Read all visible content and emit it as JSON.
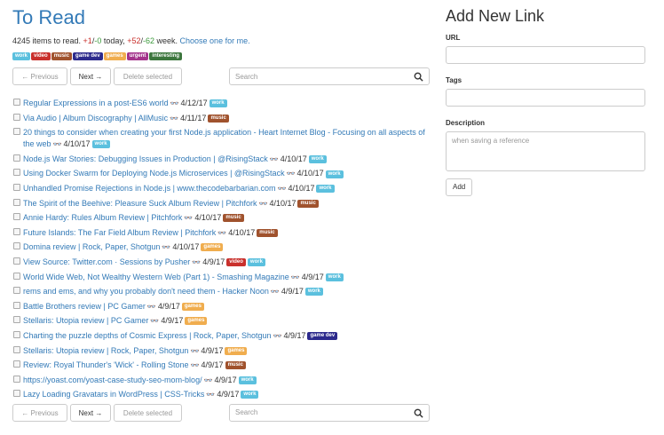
{
  "left": {
    "title": "To Read",
    "summary": {
      "items_text": "4245 items to read. ",
      "today_plus": "+1",
      "today_sep": "/",
      "today_minus": "-0",
      "today_text": " today, ",
      "week_plus": "+52",
      "week_sep": "/",
      "week_minus": "-62",
      "week_text": " week. ",
      "choose_link": "Choose one for me."
    },
    "tag_filters": [
      {
        "label": "work",
        "color": "#5bc0de"
      },
      {
        "label": "video",
        "color": "#c9302c"
      },
      {
        "label": "music",
        "color": "#a0522d"
      },
      {
        "label": "game dev",
        "color": "#2c2a8c"
      },
      {
        "label": "games",
        "color": "#f0ad4e"
      },
      {
        "label": "urgent",
        "color": "#a4348c"
      },
      {
        "label": "interesting",
        "color": "#3c763d"
      }
    ],
    "controls": {
      "previous": "← Previous",
      "next": "Next →",
      "delete": "Delete selected",
      "search_placeholder": "Search"
    },
    "links": [
      {
        "title": "Regular Expressions in a post-ES6 world",
        "date": "4/12/17",
        "tags": [
          {
            "label": "work",
            "color": "#5bc0de"
          }
        ]
      },
      {
        "title": "Via Audio | Album Discography | AllMusic",
        "date": "4/11/17",
        "tags": [
          {
            "label": "music",
            "color": "#a0522d"
          }
        ]
      },
      {
        "title": "20 things to consider when creating your first Node.js application - Heart Internet Blog - Focusing on all aspects of the web",
        "date": "4/10/17",
        "tags": [
          {
            "label": "work",
            "color": "#5bc0de"
          }
        ]
      },
      {
        "title": "Node.js War Stories: Debugging Issues in Production | @RisingStack",
        "date": "4/10/17",
        "tags": [
          {
            "label": "work",
            "color": "#5bc0de"
          }
        ]
      },
      {
        "title": "Using Docker Swarm for Deploying Node.js Microservices | @RisingStack",
        "date": "4/10/17",
        "tags": [
          {
            "label": "work",
            "color": "#5bc0de"
          }
        ]
      },
      {
        "title": "Unhandled Promise Rejections in Node.js | www.thecodebarbarian.com",
        "date": "4/10/17",
        "tags": [
          {
            "label": "work",
            "color": "#5bc0de"
          }
        ]
      },
      {
        "title": "The Spirit of the Beehive: Pleasure Suck Album Review | Pitchfork",
        "date": "4/10/17",
        "tags": [
          {
            "label": "music",
            "color": "#a0522d"
          }
        ]
      },
      {
        "title": "Annie Hardy: Rules Album Review | Pitchfork",
        "date": "4/10/17",
        "tags": [
          {
            "label": "music",
            "color": "#a0522d"
          }
        ]
      },
      {
        "title": "Future Islands: The Far Field Album Review | Pitchfork",
        "date": "4/10/17",
        "tags": [
          {
            "label": "music",
            "color": "#a0522d"
          }
        ]
      },
      {
        "title": "Domina review | Rock, Paper, Shotgun",
        "date": "4/10/17",
        "tags": [
          {
            "label": "games",
            "color": "#f0ad4e"
          }
        ]
      },
      {
        "title": "View Source: Twitter.com · Sessions by Pusher",
        "date": "4/9/17",
        "tags": [
          {
            "label": "video",
            "color": "#c9302c"
          },
          {
            "label": "work",
            "color": "#5bc0de"
          }
        ]
      },
      {
        "title": "World Wide Web, Not Wealthy Western Web (Part 1) - Smashing Magazine",
        "date": "4/9/17",
        "tags": [
          {
            "label": "work",
            "color": "#5bc0de"
          }
        ]
      },
      {
        "title": "rems and ems, and why you probably don't need them - Hacker Noon",
        "date": "4/9/17",
        "tags": [
          {
            "label": "work",
            "color": "#5bc0de"
          }
        ]
      },
      {
        "title": "Battle Brothers review | PC Gamer",
        "date": "4/9/17",
        "tags": [
          {
            "label": "games",
            "color": "#f0ad4e"
          }
        ]
      },
      {
        "title": "Stellaris: Utopia review | PC Gamer",
        "date": "4/9/17",
        "tags": [
          {
            "label": "games",
            "color": "#f0ad4e"
          }
        ]
      },
      {
        "title": "Charting the puzzle depths of Cosmic Express | Rock, Paper, Shotgun",
        "date": "4/9/17",
        "tags": [
          {
            "label": "game dev",
            "color": "#2c2a8c"
          }
        ]
      },
      {
        "title": "Stellaris: Utopia review | Rock, Paper, Shotgun",
        "date": "4/9/17",
        "tags": [
          {
            "label": "games",
            "color": "#f0ad4e"
          }
        ]
      },
      {
        "title": "Review: Royal Thunder's 'Wick' - Rolling Stone",
        "date": "4/9/17",
        "tags": [
          {
            "label": "music",
            "color": "#a0522d"
          }
        ]
      },
      {
        "title": "https://yoast.com/yoast-case-study-seo-mom-blog/",
        "date": "4/9/17",
        "tags": [
          {
            "label": "work",
            "color": "#5bc0de"
          }
        ]
      },
      {
        "title": "Lazy Loading Gravatars in WordPress | CSS-Tricks",
        "date": "4/9/17",
        "tags": [
          {
            "label": "work",
            "color": "#5bc0de"
          }
        ]
      }
    ]
  },
  "right": {
    "title": "Add New Link",
    "url_label": "URL",
    "url_value": "",
    "tags_label": "Tags",
    "tags_value": "",
    "description_label": "Description",
    "description_placeholder": "when saving a reference",
    "add_button": "Add"
  }
}
